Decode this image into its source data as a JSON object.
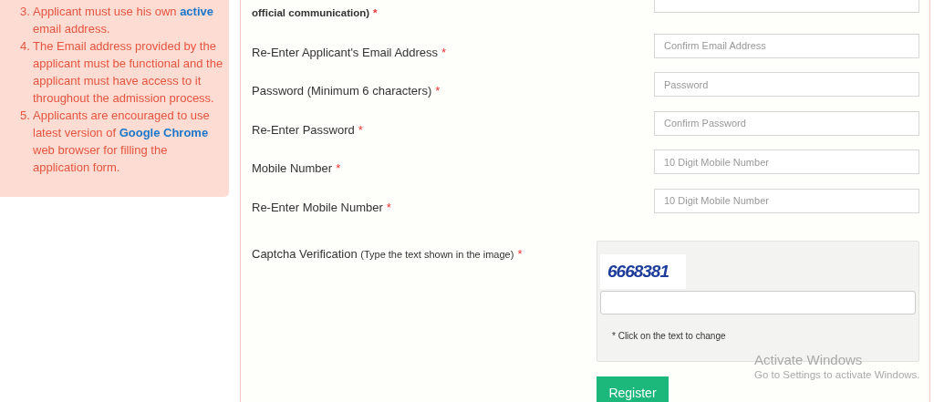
{
  "instructions": [
    {
      "number": "3.",
      "parts": [
        {
          "text": "Applicant must use his own "
        },
        {
          "text": "active",
          "kind": "link"
        },
        {
          "text": " email address."
        }
      ]
    },
    {
      "number": "4.",
      "parts": [
        {
          "text": "The Email address provided by the applicant must be functional and the applicant must have access to it throughout the admission process."
        }
      ]
    },
    {
      "number": "5.",
      "parts": [
        {
          "text": "Applicants are encouraged to use latest version of "
        },
        {
          "text": "Google Chrome",
          "kind": "link"
        },
        {
          "text": " web browser for filling the application form."
        }
      ]
    }
  ],
  "fields": [
    {
      "label": "official communication)",
      "kind": "note",
      "required_mark": "*"
    },
    {
      "label": "Re-Enter Applicant's Email Address",
      "required_mark": "*",
      "placeholder": "Confirm Email Address"
    },
    {
      "label": "Password (Minimum 6 characters)",
      "required_mark": "*",
      "placeholder": "Password"
    },
    {
      "label": "Re-Enter Password",
      "required_mark": "*",
      "placeholder": "Confirm Password"
    },
    {
      "label": "Mobile Number",
      "required_mark": "*",
      "placeholder": "10 Digit Mobile Number"
    },
    {
      "label": "Re-Enter Mobile Number",
      "required_mark": "*",
      "placeholder": "10 Digit Mobile Number"
    }
  ],
  "captcha": {
    "label": "Captcha Verification",
    "hint": "(Type the text shown in the image)",
    "required_mark": "*",
    "code": "6668381",
    "note": "* Click on the text to change"
  },
  "register_button": "Register",
  "os_notice": {
    "title": "Activate Windows",
    "subtitle": "Go to Settings to activate Windows."
  }
}
